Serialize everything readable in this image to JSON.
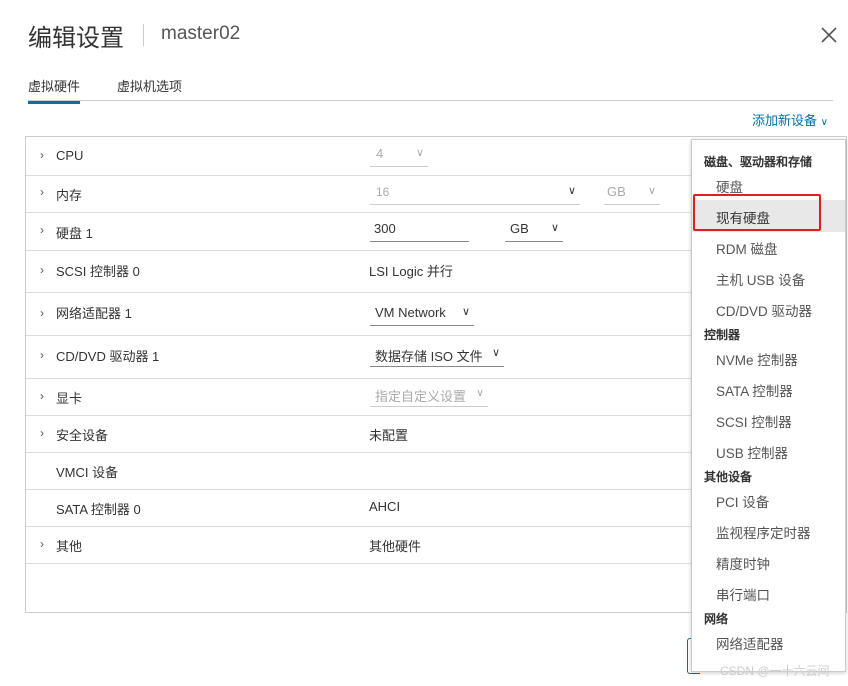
{
  "dialog": {
    "title": "编辑设置",
    "vm_name": "master02"
  },
  "tabs": [
    {
      "label": "虚拟硬件",
      "active": true
    },
    {
      "label": "虚拟机选项",
      "active": false
    }
  ],
  "add_device": {
    "label": "添加新设备",
    "icon": "chevron-down-icon"
  },
  "hardware": {
    "cpu": {
      "label": "CPU",
      "value": "4"
    },
    "memory": {
      "label": "内存",
      "value": "16",
      "unit": "GB"
    },
    "disk1": {
      "label": "硬盘 1",
      "value": "300",
      "unit": "GB"
    },
    "scsi": {
      "label": "SCSI 控制器 0",
      "value": "LSI Logic 并行"
    },
    "network": {
      "label": "网络适配器 1",
      "value": "VM Network"
    },
    "cddvd": {
      "label": "CD/DVD 驱动器 1",
      "value": "数据存储 ISO 文件"
    },
    "video": {
      "label": "显卡",
      "value": "指定自定义设置"
    },
    "security": {
      "label": "安全设备",
      "value": "未配置"
    },
    "vmci": {
      "label": "VMCI 设备",
      "value": ""
    },
    "sata": {
      "label": "SATA 控制器 0",
      "value": "AHCI"
    },
    "other": {
      "label": "其他",
      "value": "其他硬件"
    }
  },
  "menu": {
    "groups": [
      {
        "header": "磁盘、驱动器和存储",
        "items": [
          "硬盘",
          "现有硬盘",
          "RDM 磁盘",
          "主机 USB 设备",
          "CD/DVD 驱动器"
        ]
      },
      {
        "header": "控制器",
        "items": [
          "NVMe 控制器",
          "SATA 控制器",
          "SCSI 控制器",
          "USB 控制器"
        ]
      },
      {
        "header": "其他设备",
        "items": [
          "PCI 设备",
          "监视程序定时器",
          "精度时钟",
          "串行端口"
        ]
      },
      {
        "header": "网络",
        "items": [
          "网络适配器"
        ]
      }
    ],
    "highlighted": "现有硬盘"
  },
  "watermark": "CSDN @一十六云间",
  "colors": {
    "accent": "#0072a3",
    "highlight_box": "#e02020"
  }
}
